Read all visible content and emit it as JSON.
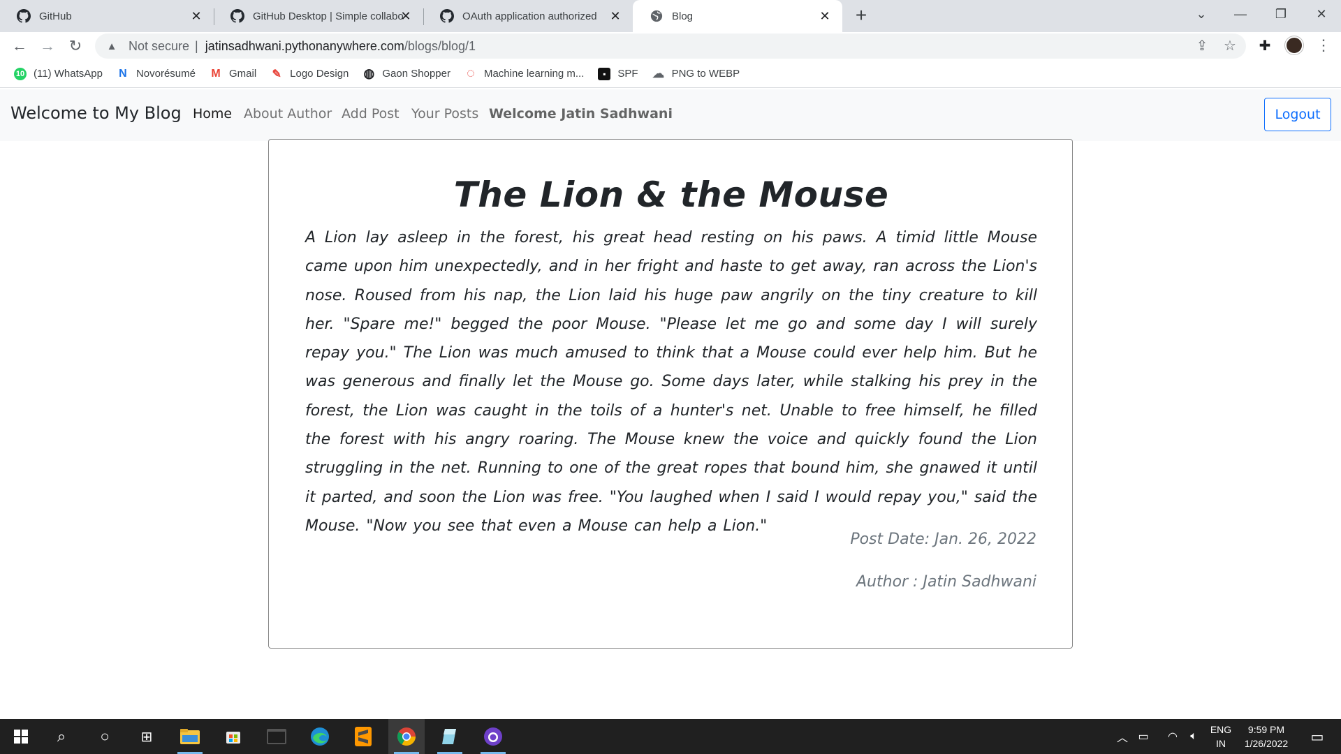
{
  "browser": {
    "tabs": [
      {
        "title": "GitHub",
        "icon": "github-icon"
      },
      {
        "title": "GitHub Desktop | Simple collabo",
        "icon": "github-icon"
      },
      {
        "title": "OAuth application authorized",
        "icon": "github-icon"
      },
      {
        "title": "Blog",
        "icon": "globe-icon",
        "active": true
      }
    ],
    "address": {
      "security_label": "Not secure",
      "host": "jatinsadhwani.pythonanywhere.com",
      "path": "/blogs/blog/1"
    },
    "bookmarks": [
      {
        "label": "(11) WhatsApp",
        "icon": "whatsapp-icon",
        "color": "#25d366",
        "badge": "10"
      },
      {
        "label": "Novorésumé",
        "icon": "novoresume-icon",
        "color": "#1a73e8",
        "badge": "N"
      },
      {
        "label": "Gmail",
        "icon": "gmail-icon",
        "color": "#ea4335",
        "badge": "M"
      },
      {
        "label": "Logo Design",
        "icon": "logo-design-icon",
        "color": "#e8453c",
        "badge": "✎"
      },
      {
        "label": "Gaon Shopper",
        "icon": "globe-icon",
        "color": "#202124",
        "badge": "◍"
      },
      {
        "label": "Machine learning m...",
        "icon": "ml-icon",
        "color": "#e53935",
        "badge": "◌"
      },
      {
        "label": "SPF",
        "icon": "spf-icon",
        "color": "#111111",
        "badge": "▪"
      },
      {
        "label": "PNG to WEBP",
        "icon": "cloud-icon",
        "color": "#5f6368",
        "badge": "☁"
      }
    ]
  },
  "site": {
    "brand": "Welcome to My Blog",
    "nav": {
      "home": "Home",
      "about": "About Author",
      "add_post": "Add Post",
      "your_posts": "Your Posts",
      "welcome": "Welcome Jatin Sadhwani",
      "logout": "Logout"
    },
    "post": {
      "title": "The Lion & the Mouse",
      "body": "A Lion lay asleep in the forest, his great head resting on his paws. A timid little Mouse came upon him unexpectedly, and in her fright and haste to get away, ran across the Lion's nose. Roused from his nap, the Lion laid his huge paw angrily on the tiny creature to kill her. \"Spare me!\" begged the poor Mouse. \"Please let me go and some day I will surely repay you.\" The Lion was much amused to think that a Mouse could ever help him. But he was generous and finally let the Mouse go. Some days later, while stalking his prey in the forest, the Lion was caught in the toils of a hunter's net. Unable to free himself, he filled the forest with his angry roaring. The Mouse knew the voice and quickly found the Lion struggling in the net. Running to one of the great ropes that bound him, she gnawed it until it parted, and soon the Lion was free. \"You laughed when I said I would repay you,\" said the Mouse. \"Now you see that even a Mouse can help a Lion.\"",
      "date_line": "Post Date: Jan. 26, 2022",
      "author_line": "Author : Jatin Sadhwani"
    }
  },
  "taskbar": {
    "language": "ENG",
    "region": "IN",
    "time": "9:59 PM",
    "date": "1/26/2022"
  }
}
